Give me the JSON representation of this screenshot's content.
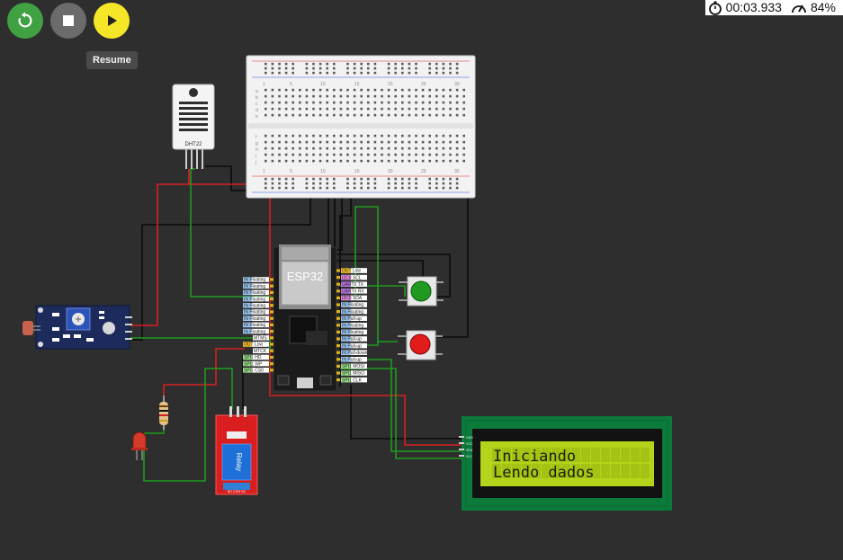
{
  "toolbar": {
    "restart_icon": "restart-icon",
    "stop_icon": "stop-icon",
    "play_icon": "play-icon",
    "tooltip": "Resume"
  },
  "status": {
    "timer": "00:03.933",
    "speed": "84%",
    "timer_icon": "stopwatch-icon",
    "speed_icon": "gauge-icon"
  },
  "colors": {
    "background": "#2e2e2e",
    "wire_red": "#d42020",
    "wire_black": "#0a0a0a",
    "wire_green": "#1f9a1f",
    "lcd_board": "#0b7a3b",
    "lcd_screen": "#b3d41a"
  },
  "dht22": {
    "label": "DHT22"
  },
  "breadboard": {
    "numbers": [
      "1",
      "5",
      "10",
      "15",
      "20",
      "25",
      "30"
    ],
    "rows_top": [
      "a",
      "b",
      "c",
      "d",
      "e"
    ],
    "rows_bottom": [
      "f",
      "g",
      "h",
      "i",
      "j"
    ]
  },
  "esp32": {
    "label": "ESP32",
    "left_pins": [
      "IN Floating",
      "IN Floating",
      "IN Floating",
      "IN Floating",
      "IN Floating",
      "IN Floating",
      "IN Floating",
      "IN Floating",
      "IN Floating",
      "MTMS",
      "OUT Low",
      "MTCK",
      "SPI1 HD",
      "SPI1 WP",
      "SPI1 CS0"
    ],
    "right_pins": [
      "OUT Low",
      "I2C0 SCL",
      "UART0 TX",
      "UART0 RX",
      "I2C0 SDA",
      "IN Floating",
      "IN Floating",
      "IN Pull-up",
      "IN Floating",
      "IN Floating",
      "IN Pull-up",
      "IN Pull-up",
      "IN Pull-down",
      "IN Pull-up",
      "SPI1 MOSI",
      "SPI1 MISO",
      "SPI1 CLK"
    ]
  },
  "relay": {
    "label": "Relay",
    "terminals": "NO COM NC"
  },
  "lcd": {
    "line1": "Iniciando",
    "line2": "Lendo dados",
    "pins": [
      "GND",
      "VCC",
      "SDA",
      "SCL"
    ]
  }
}
